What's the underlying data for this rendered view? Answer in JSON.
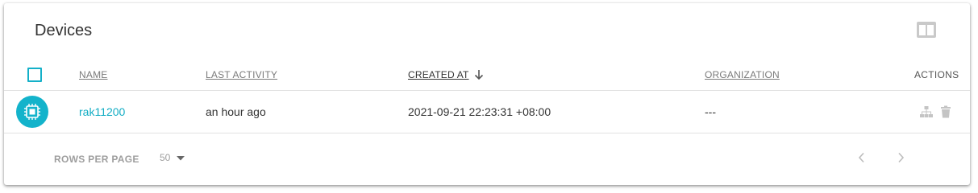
{
  "panel": {
    "title": "Devices"
  },
  "table": {
    "columns": {
      "name": "NAME",
      "last_activity": "LAST ACTIVITY",
      "created_at": "CREATED AT",
      "organization": "ORGANIZATION",
      "actions": "ACTIONS"
    },
    "sort": {
      "column": "created_at",
      "direction": "descending"
    },
    "rows": [
      {
        "icon": "chip-icon",
        "name": "rak11200",
        "last_activity": "an hour ago",
        "created_at": "2021-09-21 22:23:31 +08:00",
        "organization": "---",
        "actions": [
          "sitemap-icon",
          "trash-icon"
        ]
      }
    ]
  },
  "footer": {
    "rows_per_page_label": "ROWS PER PAGE",
    "rows_per_page_value": "50",
    "prev_icon": "chevron-left-icon",
    "next_icon": "chevron-right-icon"
  },
  "colors": {
    "accent": "#13b3cb",
    "text": "#333333",
    "muted": "#9e9e9e"
  }
}
